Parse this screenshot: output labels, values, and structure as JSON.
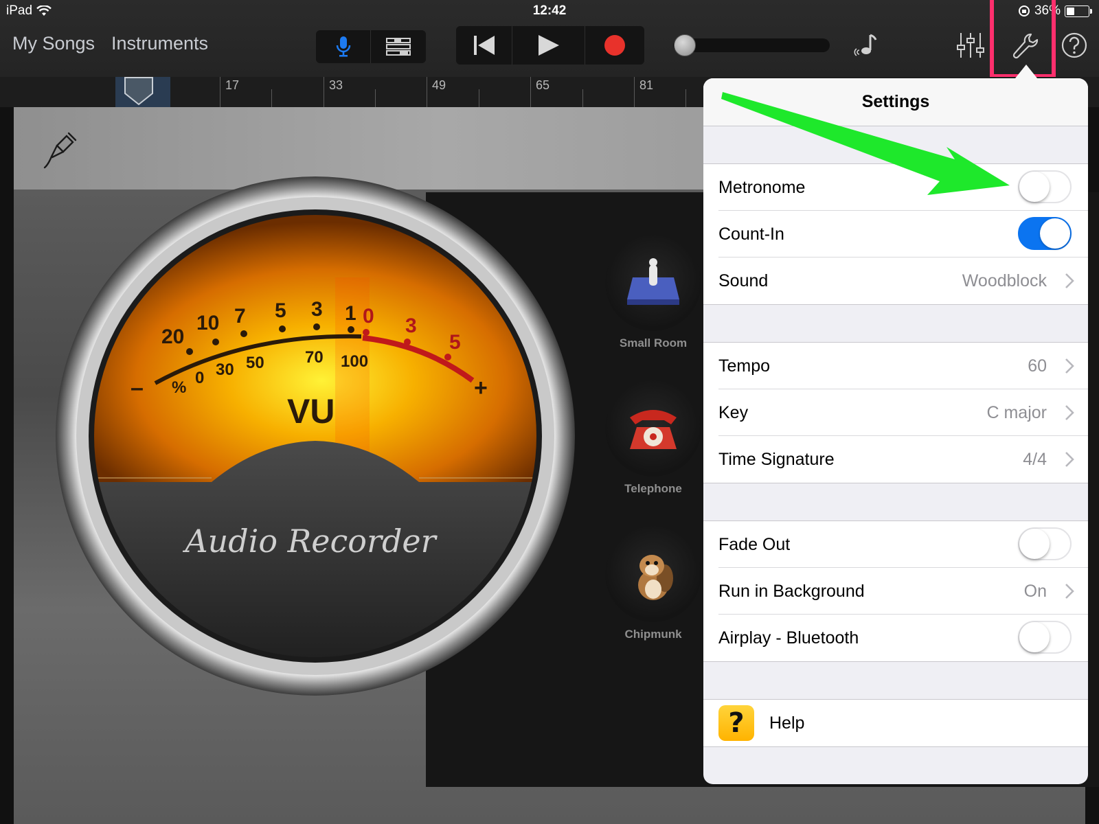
{
  "status_bar": {
    "device": "iPad",
    "time": "12:42",
    "battery": "36%",
    "battery_level": 0.36
  },
  "nav": {
    "my_songs": "My Songs",
    "instruments": "Instruments"
  },
  "icons": {
    "wifi": "wifi-icon",
    "mic": "microphone-icon",
    "tracks": "tracks-view-icon",
    "rewind": "rewind-icon",
    "play": "play-icon",
    "record": "record-icon",
    "note": "music-note-icon",
    "mixer": "mixer-icon",
    "wrench": "wrench-icon",
    "help": "help-icon",
    "cable": "input-cable-icon"
  },
  "colors": {
    "record": "#e8322b",
    "mic": "#1d7bf2",
    "toggle_on": "#0b74f0",
    "highlight": "#ff2f6d",
    "arrow": "#1ee82b",
    "help_bg": "#ffc21a"
  },
  "master_volume": 0.0,
  "ruler": {
    "labels": [
      "17",
      "33",
      "49",
      "65",
      "81"
    ]
  },
  "meter": {
    "upper_scale": [
      "20",
      "10",
      "7",
      "5",
      "3",
      "1",
      "0",
      "3",
      "5"
    ],
    "lower_scale": [
      "%",
      "0",
      "30",
      "50",
      "70",
      "100"
    ],
    "minus": "–",
    "plus": "+",
    "title": "VU",
    "brand": "Audio Recorder"
  },
  "presets": [
    {
      "label": "Small Room",
      "icon": "small-room-icon"
    },
    {
      "label": "Telephone",
      "icon": "telephone-icon"
    },
    {
      "label": "Chipmunk",
      "icon": "chipmunk-icon"
    }
  ],
  "settings": {
    "title": "Settings",
    "metronome": {
      "label": "Metronome",
      "on": false
    },
    "count_in": {
      "label": "Count-In",
      "on": true
    },
    "sound": {
      "label": "Sound",
      "value": "Woodblock"
    },
    "tempo": {
      "label": "Tempo",
      "value": "60"
    },
    "key": {
      "label": "Key",
      "value": "C major"
    },
    "time_signature": {
      "label": "Time Signature",
      "value": "4/4"
    },
    "fade_out": {
      "label": "Fade Out",
      "on": false
    },
    "run_in_background": {
      "label": "Run in Background",
      "value": "On"
    },
    "airplay": {
      "label": "Airplay - Bluetooth",
      "on": false
    },
    "help": {
      "label": "Help",
      "glyph": "?"
    }
  }
}
